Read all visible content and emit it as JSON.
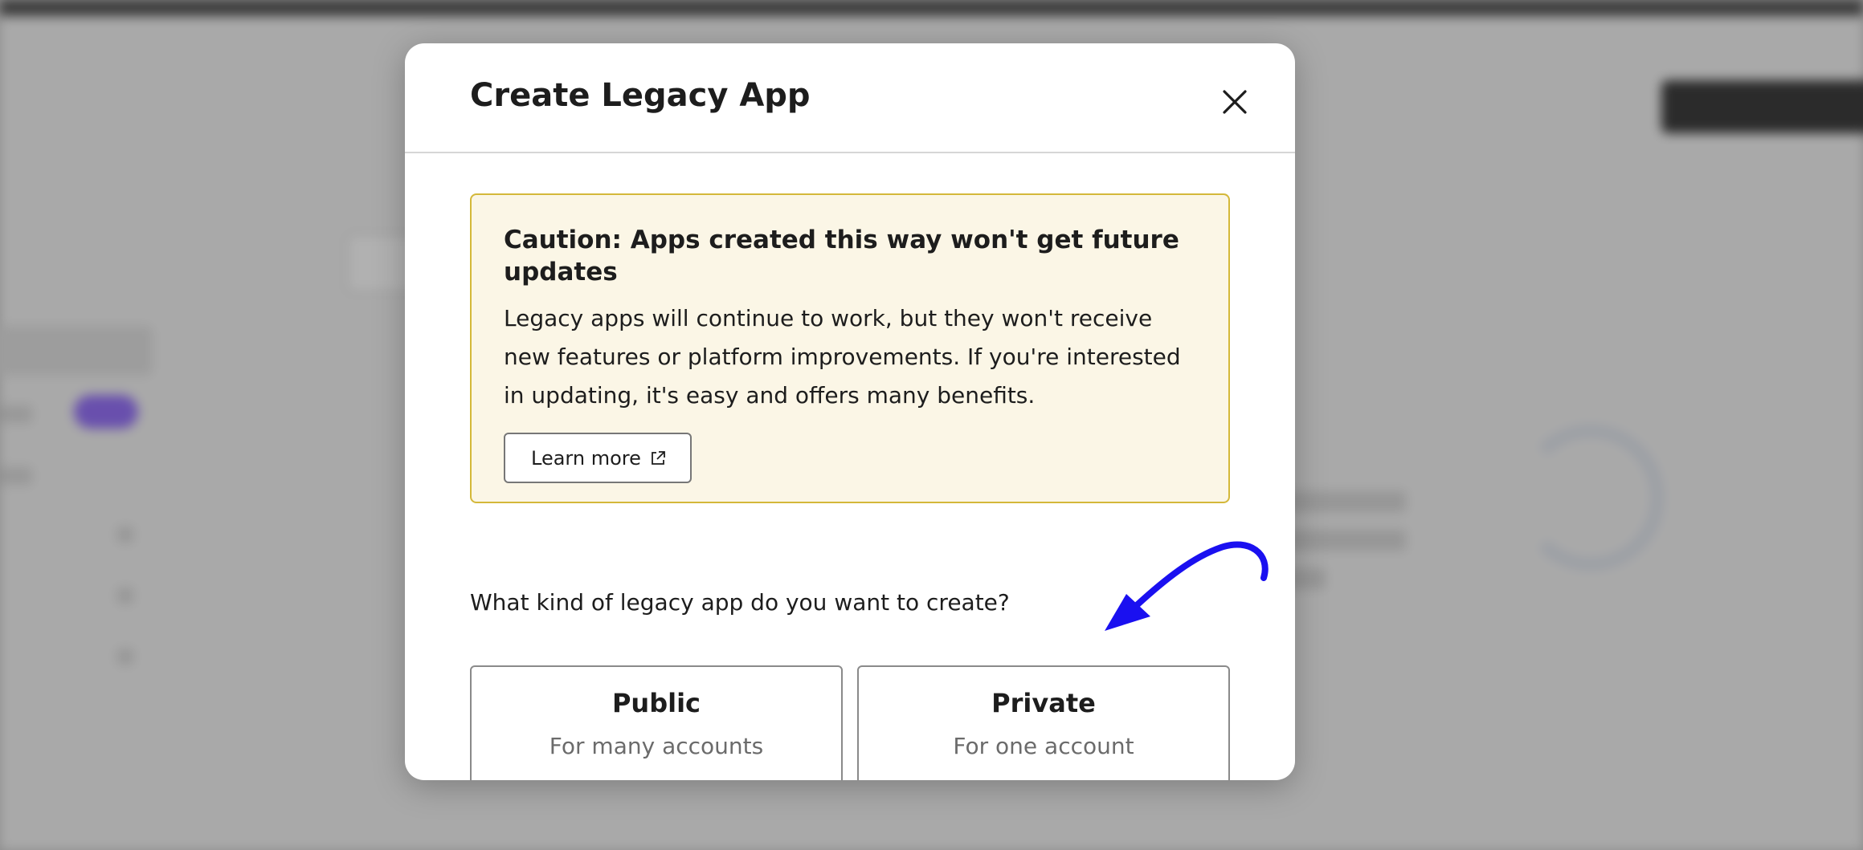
{
  "modal": {
    "title": "Create Legacy App",
    "close_icon": "close-icon"
  },
  "caution": {
    "title": "Caution: Apps created this way won't get future updates",
    "body": "Legacy apps will continue to work, but they won't receive new features or platform improvements. If you're interested in updating, it's easy and offers many benefits.",
    "learn_more_label": "Learn more",
    "learn_more_icon": "external-link-icon",
    "background_color": "#fbf6e6",
    "border_color": "#d4b83a"
  },
  "question": "What kind of legacy app do you want to create?",
  "choices": [
    {
      "title": "Public",
      "subtitle": "For many accounts"
    },
    {
      "title": "Private",
      "subtitle": "For one account"
    }
  ],
  "annotation": {
    "type": "arrow",
    "color": "#1a10f0",
    "points_to": "Private"
  }
}
